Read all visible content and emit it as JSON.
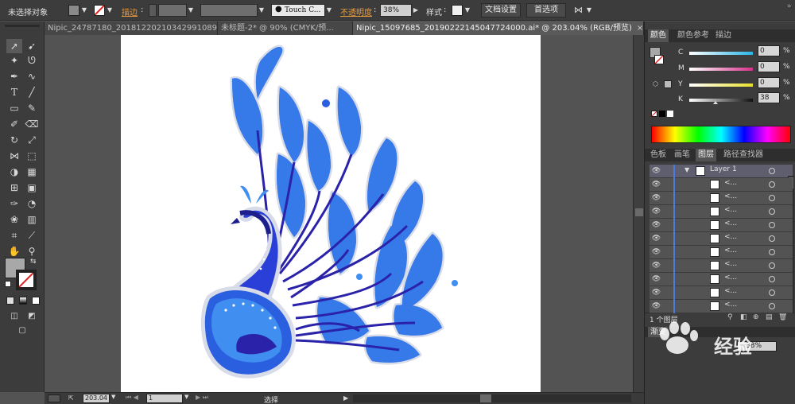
{
  "control_bar": {
    "selection_status": "未选择对象",
    "stroke_label": "描边",
    "brush_name": "Touch C...",
    "opacity_label": "不透明度",
    "opacity_value": "38%",
    "style_label": "样式",
    "doc_setup_button": "文档设置",
    "preferences_button": "首选项"
  },
  "tabs": [
    {
      "label": "Nipic_24787180_20181220210342991089.ai*",
      "active": false
    },
    {
      "label": "未标题-2* @ 90% (CMYK/预...",
      "active": false
    },
    {
      "label": "Nipic_15097685_20190222145047724000.ai* @ 203.04% (RGB/预览)",
      "active": true
    }
  ],
  "status_bar": {
    "zoom": "203.04",
    "page": "1",
    "tool_status": "选择"
  },
  "color_panel": {
    "tabs": [
      "颜色",
      "颜色参考",
      "描边"
    ],
    "channels": [
      {
        "label": "C",
        "value": "0",
        "color": "#2ab6e8"
      },
      {
        "label": "M",
        "value": "0",
        "color": "#d6318a"
      },
      {
        "label": "Y",
        "value": "0",
        "color": "#e8e02a"
      },
      {
        "label": "K",
        "value": "38",
        "color": "#111111"
      }
    ],
    "percent_sign": "%"
  },
  "layers_panel": {
    "tabs": [
      "色板",
      "画笔",
      "图层",
      "路径查找器"
    ],
    "layer_name": "Layer 1",
    "sublayer_name": "<...",
    "sublayer_count": 10,
    "footer_text": "1 个图层"
  },
  "transparency_panel": {
    "tab_label": "渐变",
    "opacity_value": "38%"
  },
  "watermark_text": "经验",
  "colors": {
    "accent_blue": "#4a7adc",
    "brand_orange": "#e89a3c",
    "peacock_light": "#3f8ef0",
    "peacock_mid": "#2a5fe0",
    "peacock_dark": "#2a22a8"
  }
}
